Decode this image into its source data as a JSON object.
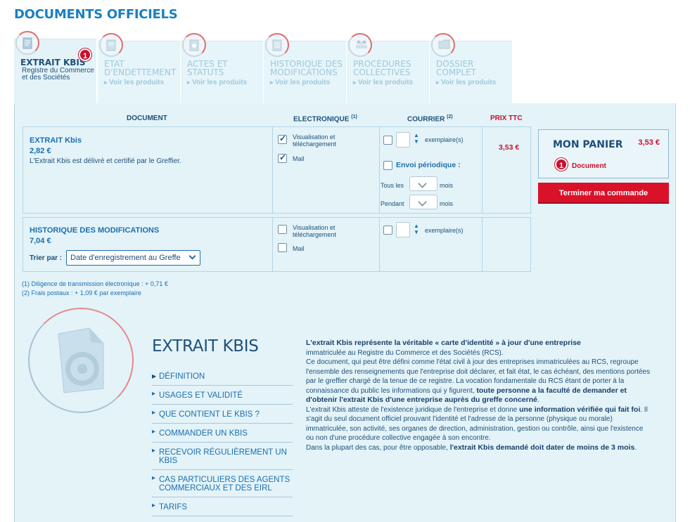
{
  "page": {
    "title": "DOCUMENTS OFFICIELS"
  },
  "tabs": [
    {
      "label": "EXTRAIT KBIS",
      "sub": "Registre du Commerce et des Sociétés",
      "badge": "1",
      "active": true,
      "icon": "document-icon"
    },
    {
      "label_l1": "ETAT",
      "label_l2": "D'ENDETTEMENT",
      "link": "Voir les produits",
      "icon": "document-icon"
    },
    {
      "label_l1": "ACTES ET",
      "label_l2": "STATUTS",
      "link": "Voir les produits",
      "icon": "stamp-icon"
    },
    {
      "label_l1": "HISTORIQUE DES",
      "label_l2": "MODIFICATIONS",
      "link": "Voir les produits",
      "icon": "list-icon"
    },
    {
      "label_l1": "PROCÉDURES",
      "label_l2": "COLLECTIVES",
      "link": "Voir les produits",
      "icon": "people-icon"
    },
    {
      "label_l1": "DOSSIER",
      "label_l2": "COMPLET",
      "link": "Voir les produits",
      "icon": "folder-icon"
    }
  ],
  "table": {
    "col_document": "DOCUMENT",
    "col_electronic": "ELECTRONIQUE",
    "col_electronic_note": "(1)",
    "col_mail": "COURRIER",
    "col_mail_note": "(2)",
    "col_price": "PRIX TTC"
  },
  "kbis": {
    "title": "EXTRAIT Kbis",
    "price": "2,82 €",
    "desc": "L'Extrait Kbis est délivré et certifié par le Greffier.",
    "opt_view_l1": "Visualisation et",
    "opt_view_l2": "téléchargement",
    "opt_view_checked": true,
    "opt_mail": "Mail",
    "opt_mail_checked": true,
    "copies": "exemplaire(s)",
    "periodic": "Envoi périodique :",
    "every": "Tous les",
    "months": "mois",
    "during": "Pendant",
    "months2": "mois",
    "total": "3,53 €"
  },
  "history": {
    "title": "HISTORIQUE DES MODIFICATIONS",
    "price": "7,04 €",
    "sort_label": "Trier par :",
    "sort_value": "Date d'enregistrement au Greffe",
    "opt_view_l1": "Visualisation et",
    "opt_view_l2": "téléchargement",
    "opt_mail": "Mail",
    "copies": "exemplaire(s)"
  },
  "cart": {
    "title": "MON PANIER",
    "price": "3,53 €",
    "count": "1",
    "item": "Document",
    "button": "Terminer ma commande"
  },
  "notes": {
    "n1": "(1) Diligence de transmission électronique : + 0,71 €",
    "n2": "(2) Frais postaux : + 1,09 € par exemplaire"
  },
  "info": {
    "title": "EXTRAIT KBIS",
    "menu": [
      "DÉFINITION",
      "USAGES ET VALIDITÉ",
      "QUE CONTIENT LE KBIS ?",
      "COMMANDER UN KBIS",
      "RECEVOIR RÉGULIÈREMENT UN KBIS",
      "CAS PARTICULIERS DES AGENTS COMMERCIAUX ET DES EIRL",
      "TARIFS"
    ],
    "p1_bold": "L'extrait Kbis représente la véritable « carte d'identité » à jour d'une entreprise",
    "p1": "immatriculée au Registre du Commerce et des Sociétés (RCS).",
    "p2": "Ce document, qui peut être défini comme l'état civil à jour des entreprises immatriculées au RCS, regroupe l'ensemble des renseignements que l'entreprise doit déclarer, et fait état, le cas échéant, des mentions portées par le greffier chargé de la tenue de ce registre. La vocation fondamentale du RCS étant de porter à la connaissance du public les informations qui y figurent,",
    "p2_bold": "toute personne a la faculté de demander et d'obtenir l'extrait Kbis d'une entreprise auprès du greffe concerné",
    "p2_end": ".",
    "p3": "L'extrait Kbis atteste de l'existence juridique de l'entreprise et donne",
    "p3_bold": "une information vérifiée qui fait foi",
    "p3_end": ". Il s'agit du seul document officiel prouvant l'identité et l'adresse de la personne (physique ou morale) immatriculée, son activité, ses organes de direction, administration, gestion ou contrôle, ainsi que l'existence ou non d'une procédure collective engagée à son encontre.",
    "p4": "Dans la plupart des cas, pour être opposable,",
    "p4_bold": "l'extrait Kbis demandé doit dater de moins de 3 mois",
    "p4_end": "."
  }
}
